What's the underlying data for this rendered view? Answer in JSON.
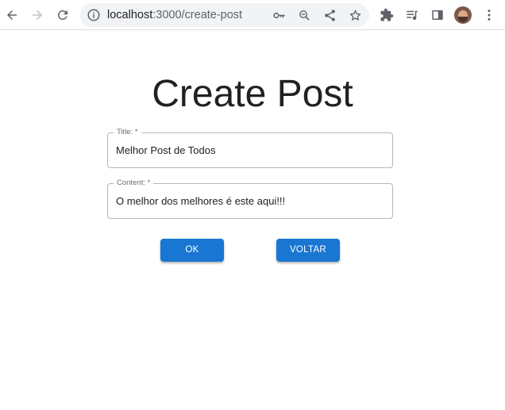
{
  "browser": {
    "url_host": "localhost",
    "url_rest": ":3000/create-post",
    "icons": {
      "back": "arrow-left-icon",
      "forward": "arrow-right-icon",
      "reload": "reload-icon",
      "site_info": "info-icon",
      "password": "key-icon",
      "zoom": "zoom-out-icon",
      "share": "share-icon",
      "bookmark": "star-icon",
      "extensions": "puzzle-icon",
      "media": "media-queue-icon",
      "side_panel": "side-panel-icon",
      "menu": "kebab-menu-icon"
    }
  },
  "page": {
    "title": "Create Post"
  },
  "form": {
    "title_label": "Title: *",
    "title_value": "Melhor Post de Todos",
    "content_label": "Content: *",
    "content_value": "O melhor dos melhores é este aqui!!!",
    "ok_label": "OK",
    "back_label": "VOLTAR"
  },
  "colors": {
    "primary": "#1976d2",
    "border": "#b7b7b7",
    "omnibox_bg": "#f1f3f4",
    "icon": "#5f6368"
  }
}
